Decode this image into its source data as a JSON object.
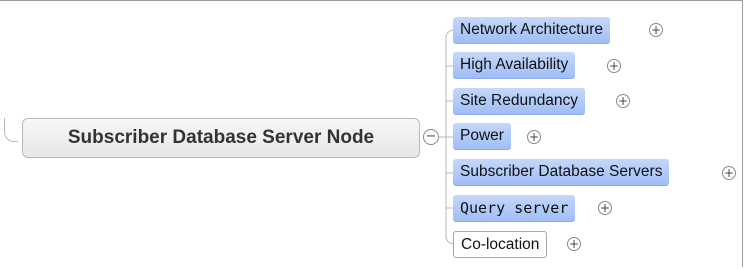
{
  "root": {
    "label": "Subscriber Database Server Node",
    "collapse_symbol": "−"
  },
  "children": [
    {
      "label": "Network Architecture",
      "expand_symbol": "+",
      "style": "blue"
    },
    {
      "label": "High Availability",
      "expand_symbol": "+",
      "style": "blue"
    },
    {
      "label": "Site Redundancy",
      "expand_symbol": "+",
      "style": "blue"
    },
    {
      "label": "Power",
      "expand_symbol": "+",
      "style": "blue"
    },
    {
      "label": "Subscriber Database Servers",
      "expand_symbol": "+",
      "style": "blue"
    },
    {
      "label": "Query server",
      "expand_symbol": "+",
      "style": "blue-mono"
    },
    {
      "label": "Co-location",
      "expand_symbol": "+",
      "style": "white"
    }
  ],
  "colors": {
    "topic_fill": "#b3cdf8",
    "root_fill": "#efefef",
    "connector": "#b8b8b8"
  }
}
